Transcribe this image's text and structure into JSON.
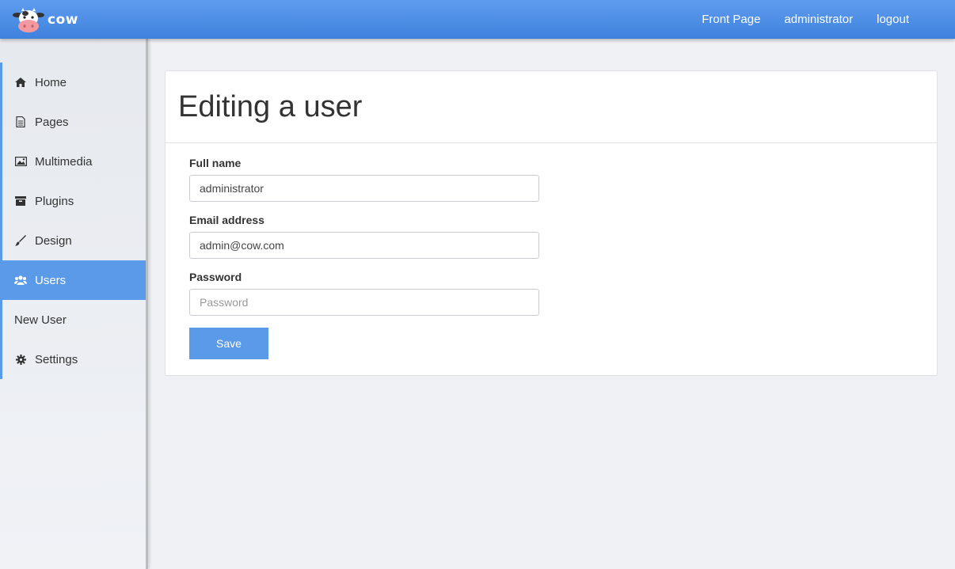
{
  "app": {
    "name": "cow"
  },
  "topnav": {
    "front_page": "Front Page",
    "user": "administrator",
    "logout": "logout"
  },
  "sidebar": {
    "items": [
      {
        "label": "Home",
        "icon": "home-icon"
      },
      {
        "label": "Pages",
        "icon": "document-icon"
      },
      {
        "label": "Multimedia",
        "icon": "image-icon"
      },
      {
        "label": "Plugins",
        "icon": "archive-icon"
      },
      {
        "label": "Design",
        "icon": "brush-icon"
      },
      {
        "label": "Users",
        "icon": "users-icon",
        "active": true
      },
      {
        "label": "New User",
        "icon": ""
      },
      {
        "label": "Settings",
        "icon": "gear-icon"
      }
    ]
  },
  "main": {
    "title": "Editing a user",
    "form": {
      "full_name_label": "Full name",
      "full_name_value": "administrator",
      "email_label": "Email address",
      "email_value": "admin@cow.com",
      "password_label": "Password",
      "password_placeholder": "Password",
      "save_label": "Save"
    }
  },
  "colors": {
    "accent": "#5a9ae8",
    "topbar": "#4a8ce6"
  }
}
